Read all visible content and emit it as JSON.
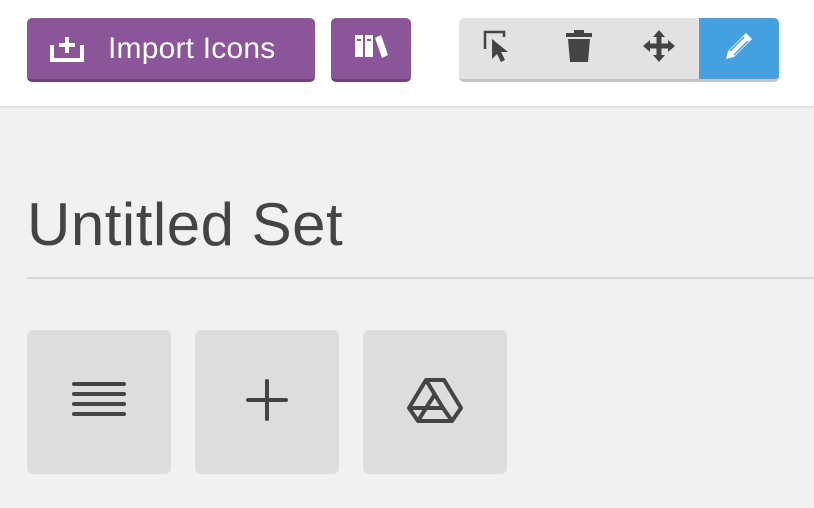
{
  "toolbar": {
    "import_label": "Import Icons",
    "import_icon": "import-icon",
    "library_icon": "library-icon",
    "tools": [
      {
        "name": "select",
        "icon": "cursor-select-icon",
        "active": false
      },
      {
        "name": "delete",
        "icon": "trash-icon",
        "active": false
      },
      {
        "name": "move",
        "icon": "move-icon",
        "active": false
      },
      {
        "name": "edit",
        "icon": "pencil-icon",
        "active": true
      }
    ],
    "colors": {
      "purple": "#8a5699",
      "active_blue": "#44a0de",
      "tool_gray": "#e2e2e2"
    }
  },
  "set": {
    "title": "Untitled Set",
    "icons": [
      {
        "icon": "menu-lines-icon"
      },
      {
        "icon": "plus-icon"
      },
      {
        "icon": "google-drive-icon"
      }
    ]
  }
}
